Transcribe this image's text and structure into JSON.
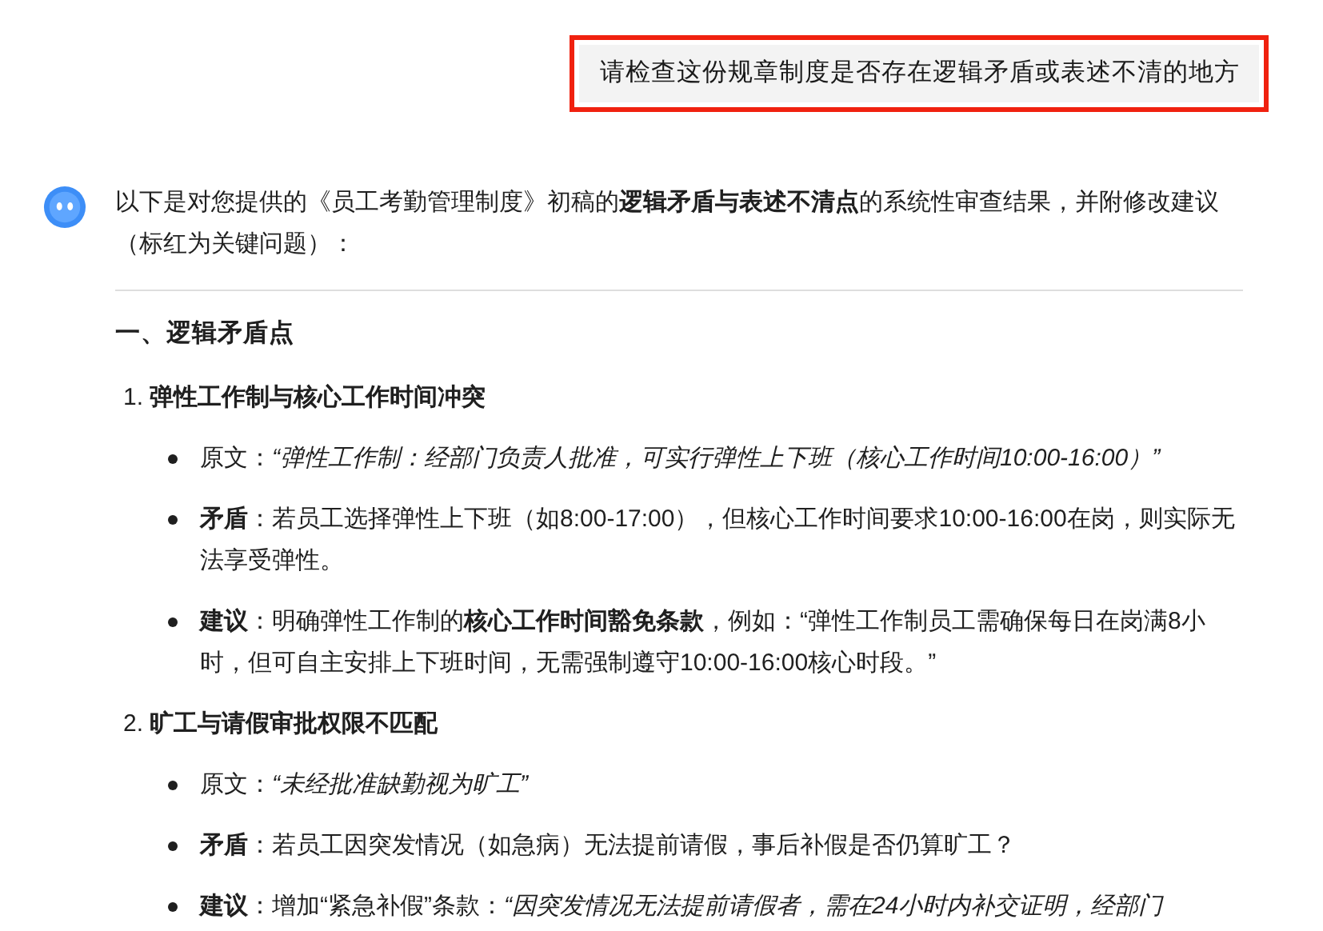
{
  "user_message": {
    "text": "请检查这份规章制度是否存在逻辑矛盾或表述不清的地方",
    "highlighted": true
  },
  "reply": {
    "intro": "以下是对您提供的《员工考勤管理制度》初稿的**逻辑矛盾与表述不清点**的系统性审查结果，并附修改建议（标红为关键问题）：",
    "section_heading": "一、逻辑矛盾点",
    "items": [
      {
        "number": "1.",
        "title": "弹性工作制与核心工作时间冲突",
        "bullets": [
          "原文：*“弹性工作制：经部门负责人批准，可实行弹性上下班（核心工作时间10:00-16:00）”*",
          "**矛盾**：若员工选择弹性上下班（如8:00-17:00），但核心工作时间要求10:00-16:00在岗，则实际无法享受弹性。",
          "**建议**：明确弹性工作制的**核心工作时间豁免条款**，例如：“弹性工作制员工需确保每日在岗满8小时，但可自主安排上下班时间，无需强制遵守10:00-16:00核心时段。”"
        ]
      },
      {
        "number": "2.",
        "title": "旷工与请假审批权限不匹配",
        "bullets": [
          "原文：*“未经批准缺勤视为旷工”*",
          "**矛盾**：若员工因突发情况（如急病）无法提前请假，事后补假是否仍算旷工？",
          "**建议**：增加“紧急补假”条款：*“因突发情况无法提前请假者，需在24小时内补交证明，经部门*"
        ]
      }
    ]
  }
}
